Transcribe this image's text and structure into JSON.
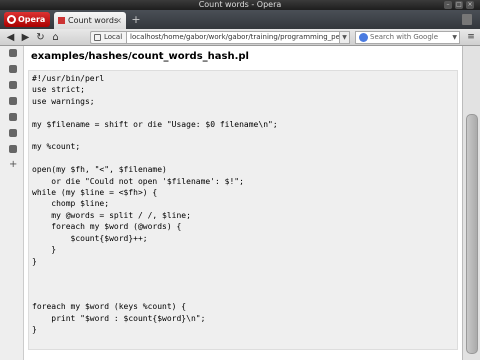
{
  "window": {
    "title": "Count words - Opera",
    "controls": [
      "–",
      "□",
      "×"
    ]
  },
  "tabs": {
    "menu_label": "Opera",
    "active_tab": "Count words",
    "close_glyph": "×",
    "add_glyph": "+"
  },
  "toolbar": {
    "back": "◀",
    "forward": "▶",
    "reload": "↻",
    "home": "⌂",
    "local_label": "Local",
    "url": "localhost/home/gabor/work/gabor/training/programming_per",
    "search_placeholder": "Search with Google",
    "menu_glyph": "≡"
  },
  "side_panel_icons": [
    "bookmarks-icon",
    "speed-dial-icon",
    "history-icon",
    "notes-icon",
    "mail-icon",
    "transfers-icon",
    "links-icon",
    "add-panel-icon"
  ],
  "page": {
    "heading": "examples/hashes/count_words_hash.pl",
    "code": "#!/usr/bin/perl\nuse strict;\nuse warnings;\n\nmy $filename = shift or die \"Usage: $0 filename\\n\";\n\nmy %count;\n\nopen(my $fh, \"<\", $filename)\n    or die \"Could not open '$filename': $!\";\nwhile (my $line = <$fh>) {\n    chomp $line;\n    my @words = split / /, $line;\n    foreach my $word (@words) {\n        $count{$word}++;\n    }\n}\n\n\n\nforeach my $word (keys %count) {\n    print \"$word : $count{$word}\\n\";\n}"
  },
  "colors": {
    "code_background": "#efefef",
    "tab_accent": "#cc3333"
  }
}
